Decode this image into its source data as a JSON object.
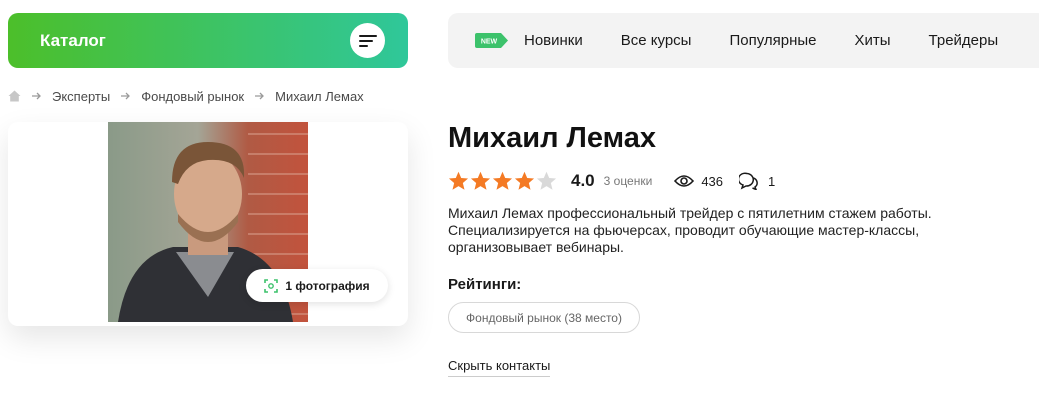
{
  "catalog": {
    "label": "Каталог",
    "menu_icon": "menu-lines-icon"
  },
  "topnav": {
    "new_badge": "NEW",
    "items": [
      "Новинки",
      "Все курсы",
      "Популярные",
      "Хиты",
      "Трейдеры"
    ]
  },
  "breadcrumb": {
    "home_icon": "home-icon",
    "items": [
      "Эксперты",
      "Фондовый рынок",
      "Михаил Лемах"
    ]
  },
  "photo": {
    "button_label": "1 фотография",
    "button_icon": "scan-icon"
  },
  "profile": {
    "name": "Михаил Лемах",
    "rating": 4,
    "rating_max": 5,
    "rating_value": "4.0",
    "rating_count": "3 оценки",
    "views": "436",
    "comments": "1",
    "description": "Михаил Лемах профессиональный трейдер с пятилетним стажем работы. Специализируется на фьючерсах, проводит обучающие мастер-классы, организовывает вебинары.",
    "ratings_title": "Рейтинги:",
    "ratings_tag": "Фондовый рынок (38 место)",
    "hide_contacts": "Скрыть контакты"
  },
  "colors": {
    "accent_start": "#4cbf2a",
    "accent_end": "#2fc79a",
    "star_filled": "#f47a24",
    "star_empty": "#d9d9d9",
    "new_badge": "#3cc26b"
  }
}
